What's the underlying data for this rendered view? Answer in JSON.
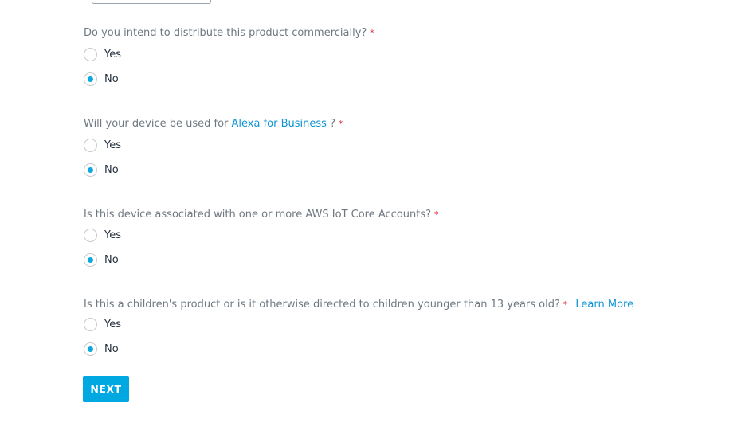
{
  "questions": [
    {
      "text": "Do you intend to distribute this product commercially?",
      "required_mark": "*",
      "options": [
        {
          "label": "Yes",
          "selected": false
        },
        {
          "label": "No",
          "selected": true
        }
      ]
    },
    {
      "text_before": "Will your device be used for ",
      "link": "Alexa for Business",
      "text_after": " ?",
      "required_mark": "*",
      "options": [
        {
          "label": "Yes",
          "selected": false
        },
        {
          "label": "No",
          "selected": true
        }
      ]
    },
    {
      "text": "Is this device associated with one or more AWS IoT Core Accounts?",
      "required_mark": "*",
      "options": [
        {
          "label": "Yes",
          "selected": false
        },
        {
          "label": "No",
          "selected": true
        }
      ]
    },
    {
      "text": "Is this a children's product or is it otherwise directed to children younger than 13 years old?",
      "required_mark": "*",
      "learn_more": "Learn More",
      "options": [
        {
          "label": "Yes",
          "selected": false
        },
        {
          "label": "No",
          "selected": true
        }
      ]
    }
  ],
  "next_button": "NEXT",
  "colors": {
    "accent": "#00a8e1",
    "link": "#0e94d4",
    "required": "#e0293a",
    "question_text": "#6f7880",
    "label_text": "#232f3e"
  }
}
